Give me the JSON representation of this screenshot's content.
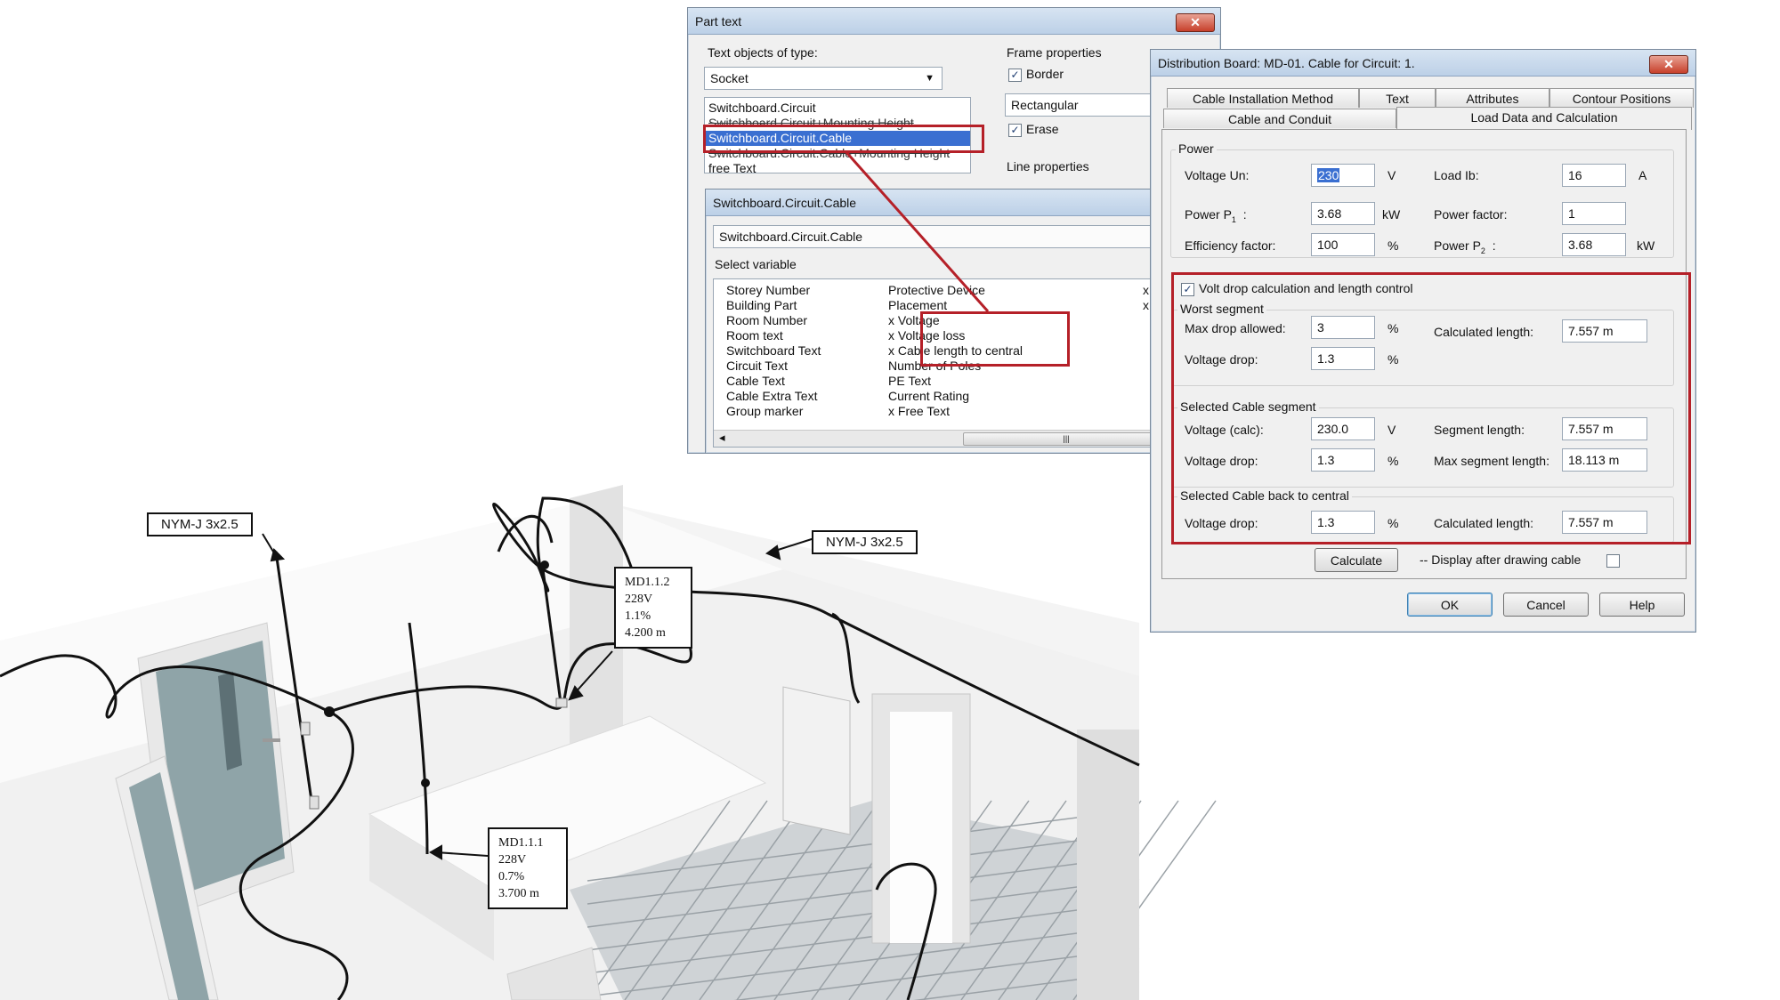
{
  "scene": {
    "tag_left": "NYM-J 3x2.5",
    "tag_right": "NYM-J 3x2.5",
    "callout_top": {
      "id": "MD1.1.2",
      "voltage": "228V",
      "drop": "1.1%",
      "length": "4.200 m"
    },
    "callout_bottom": {
      "id": "MD1.1.1",
      "voltage": "228V",
      "drop": "0.7%",
      "length": "3.700 m"
    }
  },
  "part_text": {
    "title": "Part text",
    "close": "✕",
    "type_label": "Text objects of type:",
    "type_value": "Socket",
    "list_items": [
      "Switchboard.Circuit",
      "Switchboard.Circuit+Mounting Height",
      "Switchboard.Circuit.Cable",
      "Switchboard.Circuit.Cable+Mounting Height",
      "free Text"
    ],
    "frame_label": "Frame properties",
    "border_label": "Border",
    "border_check": "✓",
    "shape_value": "Rectangular",
    "erase_label": "Erase",
    "erase_check": "✓",
    "line_label": "Line properties"
  },
  "variables": {
    "title": "Switchboard.Circuit.Cable",
    "field_value": "Switchboard.Circuit.Cable",
    "select_label": "Select variable",
    "left_column": [
      "Storey Number",
      "Building Part",
      "Room Number",
      "Room text",
      "Switchboard Text",
      "Circuit Text",
      "Cable Text",
      "Cable Extra Text",
      "Group marker"
    ],
    "right_column": [
      "Protective Device",
      "Placement",
      "x Voltage",
      "x Voltage loss",
      "x Cable length to central",
      "Number of Poles",
      "PE Text",
      "Current Rating",
      "x  Free Text"
    ],
    "far_right": [
      "x",
      "x"
    ],
    "scroll_left": "◂",
    "scroll_thumb": "|||"
  },
  "dist_board": {
    "title": "Distribution Board: MD-01. Cable for Circuit: 1.",
    "close": "✕",
    "tabs_row1": [
      "Cable Installation Method",
      "Text",
      "Attributes",
      "Contour Positions"
    ],
    "tabs_row2": [
      "Cable and Conduit",
      "Load Data and Calculation"
    ],
    "power": {
      "group": "Power",
      "voltage_label": "Voltage Un:",
      "voltage_value": "230",
      "voltage_unit": "V",
      "load_label": "Load Ib:",
      "load_value": "16",
      "load_unit": "A",
      "p1_label": "Power P",
      "p1_sub": "1",
      "p1_colon": ":",
      "p1_value": "3.68",
      "p1_unit": "kW",
      "pf_label": "Power factor:",
      "pf_value": "1",
      "eff_label": "Efficiency factor:",
      "eff_value": "100",
      "eff_unit": "%",
      "p2_label": "Power P",
      "p2_sub": "2",
      "p2_colon": ":",
      "p2_value": "3.68",
      "p2_unit": "kW"
    },
    "volt_drop_check_label": "Volt drop calculation and length control",
    "volt_drop_check": "✓",
    "worst": {
      "group": "Worst segment",
      "max_drop_label": "Max drop allowed:",
      "max_drop_value": "3",
      "max_drop_unit": "%",
      "calc_len_label": "Calculated length:",
      "calc_len_value": "7.557 m",
      "vdrop_label": "Voltage drop:",
      "vdrop_value": "1.3",
      "vdrop_unit": "%"
    },
    "selected": {
      "group": "Selected Cable segment",
      "vcalc_label": "Voltage (calc):",
      "vcalc_value": "230.0",
      "vcalc_unit": "V",
      "seg_len_label": "Segment length:",
      "seg_len_value": "7.557 m",
      "vdrop_label": "Voltage drop:",
      "vdrop_value": "1.3",
      "vdrop_unit": "%",
      "max_seg_label": "Max segment length:",
      "max_seg_value": "18.113 m"
    },
    "back": {
      "group": "Selected Cable back to central",
      "vdrop_label": "Voltage drop:",
      "vdrop_value": "1.3",
      "vdrop_unit": "%",
      "calc_len_label": "Calculated length:",
      "calc_len_value": "7.557 m"
    },
    "calculate_label": "Calculate",
    "display_label": "-- Display after drawing cable",
    "ok_label": "OK",
    "cancel_label": "Cancel",
    "help_label": "Help"
  },
  "colors": {
    "highlight": "#b52028",
    "selection": "#3a6fd1"
  }
}
